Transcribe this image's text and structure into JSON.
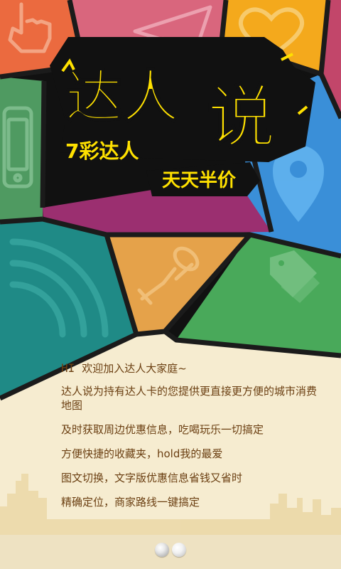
{
  "colors": {
    "pink_top": "#d9667d",
    "orange_top": "#eb6a3f",
    "yellow_top": "#f4a91c",
    "teal_top": "#49aeb0",
    "green_left": "#4f9a61",
    "blue_right": "#3a8fd8",
    "purple_center": "#9b2f70",
    "teal_lower": "#1f8a86",
    "orange_center": "#e5a24a",
    "green_lower": "#49a95a",
    "cream": "#f6ecd0",
    "text_brown": "#6b3f12",
    "logo_yellow": "#ffe100"
  },
  "logo": {
    "title_part1": "达人",
    "title_part2": "说",
    "tagline1": "7彩达人",
    "tagline2": "天天半价"
  },
  "intro": {
    "hi": "HI",
    "greeting": "欢迎加入达人大家庭~",
    "features": [
      "达人说为持有达人卡的您提供更直接更方便的城市消费地图",
      "及时获取周边优惠信息，吃喝玩乐一切搞定",
      "方便快捷的收藏夹，hold我的最爱",
      "图文切换，文字版优惠信息省钱又省时",
      "精确定位，商家路线一键搞定"
    ]
  },
  "pager": {
    "current_page": 1,
    "total_pages": 2
  },
  "icons": [
    "hand-pointer-icon",
    "paper-plane-icon",
    "heart-icon",
    "smartphone-icon",
    "map-pin-icon",
    "wifi-signal-icon",
    "pushpin-icon",
    "price-tag-icon",
    "city-skyline"
  ]
}
